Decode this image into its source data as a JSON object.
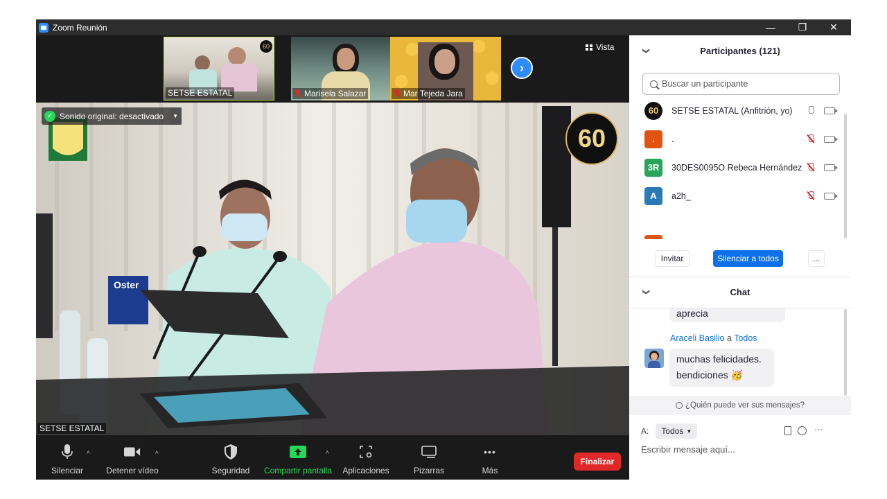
{
  "window": {
    "title": "Zoom Reunión",
    "minimize_icon": "—",
    "restore_icon": "❐",
    "close_icon": "✕"
  },
  "thumbnails": [
    {
      "name": "SETSE ESTATAL",
      "muted": false
    },
    {
      "name": "Marisela Salazar",
      "muted": true
    },
    {
      "name": "Mar Tejeda Jara",
      "muted": true
    }
  ],
  "view_button": "Vista",
  "next_page_icon": "›",
  "main_video": {
    "speaker_name": "SETSE ESTATAL",
    "original_sound": "Sonido original: desactivado",
    "badge_number": "60"
  },
  "toolbar": {
    "mute": "Silenciar",
    "stop_video": "Detener vídeo",
    "security": "Seguridad",
    "share_screen": "Compartir pantalla",
    "apps": "Aplicaciones",
    "whiteboards": "Pizarras",
    "more": "Más",
    "end": "Finalizar",
    "more_icon": "•••",
    "caret": "^"
  },
  "participants": {
    "title": "Participantes (121)",
    "search_placeholder": "Buscar un participante",
    "rows": [
      {
        "avatar": "60",
        "name": "SETSE ESTATAL (Anfitrión, yo)",
        "avatar_color": "#1a1a1a",
        "muted": false
      },
      {
        "avatar": ".",
        "name": ".",
        "avatar_color": "#e0540f",
        "muted": true
      },
      {
        "avatar": "3R",
        "name": "30DES0095O  Rebeca Hernández",
        "avatar_color": "#27a55a",
        "muted": true
      },
      {
        "avatar": "A",
        "name": "a2h_",
        "avatar_color": "#2a7ab8",
        "muted": true
      }
    ],
    "invite": "Invitar",
    "mute_all": "Silenciar a todos",
    "more": "..."
  },
  "chat": {
    "title": "Chat",
    "prev_message": "aprecia",
    "author": "Araceli Basilio",
    "to_word": "a",
    "recipient": "Todos",
    "message_line1": "muchas felicidades.",
    "message_line2": "bendiciones",
    "emoji": "🥳",
    "who_can_see": "¿Quién puede ver sus mensajes?",
    "to_label": "A:",
    "to_select": "Todos",
    "input_placeholder": "Escribir mensaje aquí..."
  }
}
